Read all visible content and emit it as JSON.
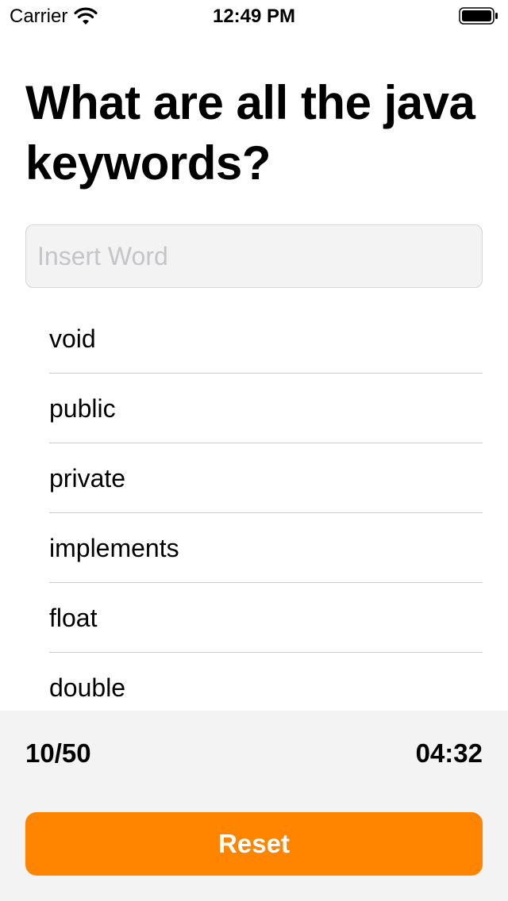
{
  "status_bar": {
    "carrier": "Carrier",
    "time": "12:49 PM",
    "icons": [
      "wifi-icon",
      "battery-icon"
    ]
  },
  "question": {
    "title": "What are all the java keywords?"
  },
  "input": {
    "value": "",
    "placeholder": "Insert Word"
  },
  "words": {
    "items": [
      "void",
      "public",
      "private",
      "implements",
      "float",
      "double"
    ]
  },
  "footer": {
    "score": "10/50",
    "timer": "04:32",
    "reset_label": "Reset"
  },
  "colors": {
    "accent": "#ff8400",
    "panel_background": "#f3f3f4",
    "input_background": "#f3f3f4",
    "placeholder": "#c5c5c9",
    "divider": "#cfcfd2"
  }
}
